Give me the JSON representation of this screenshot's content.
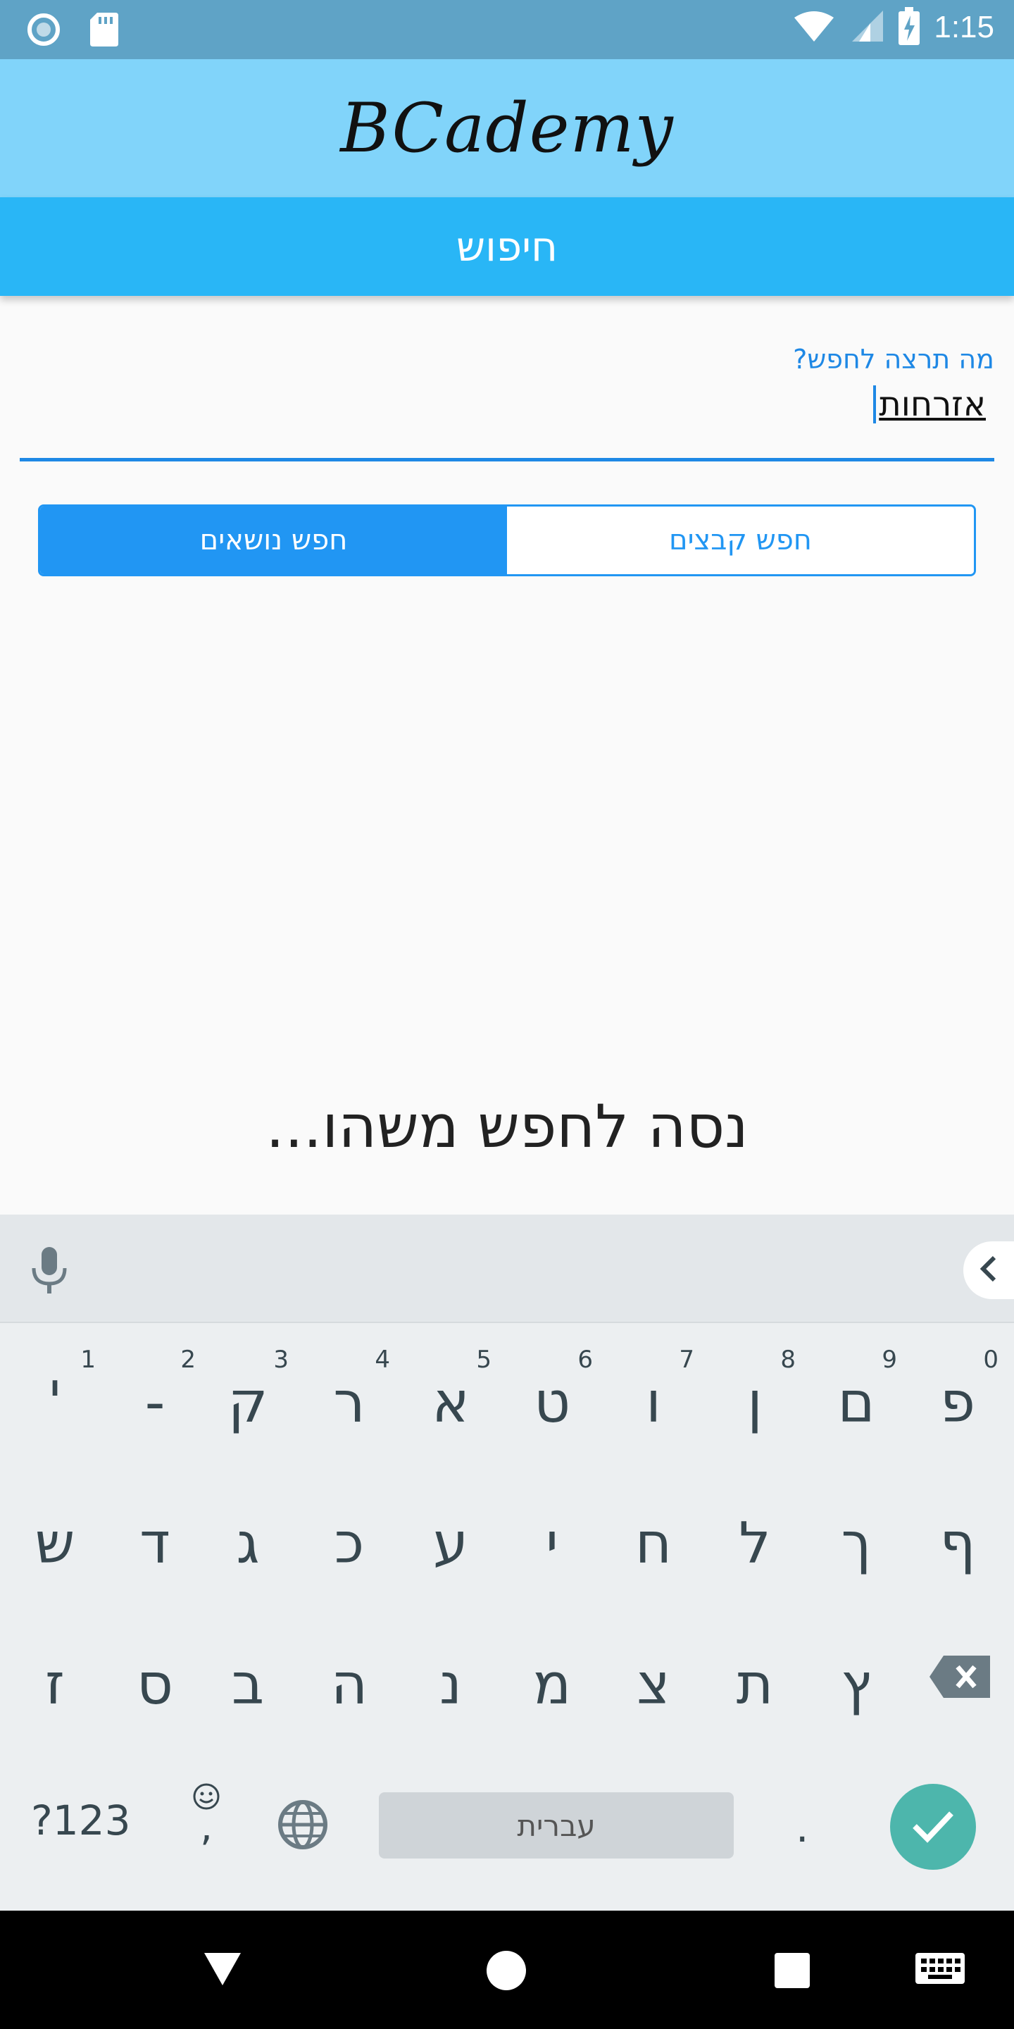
{
  "status_bar": {
    "time": "1:15"
  },
  "app_header": {
    "logo_text": "BCademy"
  },
  "section_bar": {
    "title": "חיפוש"
  },
  "search": {
    "label": "מה תרצה לחפש?",
    "value": "אזרחות"
  },
  "segments": {
    "files_label": "חפש קבצים",
    "topics_label": "חפש נושאים",
    "selected": "topics"
  },
  "empty_state": {
    "message": "נסה לחפש משהו..."
  },
  "keyboard": {
    "row1": [
      {
        "k": "פ",
        "h": "0"
      },
      {
        "k": "ם",
        "h": "9"
      },
      {
        "k": "ן",
        "h": "8"
      },
      {
        "k": "ו",
        "h": "7"
      },
      {
        "k": "ט",
        "h": "6"
      },
      {
        "k": "א",
        "h": "5"
      },
      {
        "k": "ר",
        "h": "4"
      },
      {
        "k": "ק",
        "h": "3"
      },
      {
        "k": "-",
        "h": "2"
      },
      {
        "k": "'",
        "h": "1"
      }
    ],
    "row2": [
      "ף",
      "ך",
      "ל",
      "ח",
      "י",
      "ע",
      "כ",
      "ג",
      "ד",
      "ש"
    ],
    "row3": [
      "ץ",
      "ת",
      "צ",
      "מ",
      "נ",
      "ה",
      "ב",
      "ס",
      "ז"
    ],
    "symbols_label": "?123",
    "comma_label": ",",
    "space_label": "עברית",
    "period_label": ".",
    "colors": {
      "enter": "#4db6ac",
      "accent": "#2196f3"
    }
  }
}
